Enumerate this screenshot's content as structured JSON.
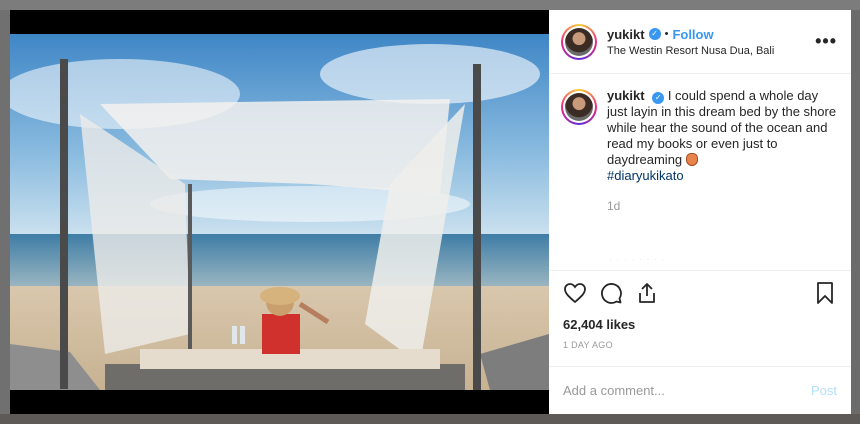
{
  "post": {
    "username": "yukikt",
    "follow_label": "Follow",
    "dot": "•",
    "location": "The Westin Resort Nusa Dua, Bali",
    "more_label": "•••",
    "caption_text": "I could spend a whole day just layin in this dream bed by the shore while hear the sound of the ocean and read my books or even just to daydreaming",
    "hashtag": "#diaryukikato",
    "caption_age": "1d",
    "likes": "62,404 likes",
    "time_ago": "1 DAY AGO",
    "comment_placeholder": "Add a comment...",
    "post_label": "Post"
  },
  "icons": {
    "verified": "verified-badge-icon",
    "like": "heart-icon",
    "comment": "comment-icon",
    "share": "share-icon",
    "save": "bookmark-icon"
  },
  "colors": {
    "link_blue": "#3897f0",
    "hashtag": "#003569",
    "muted": "#999999",
    "post_disabled": "#b2dffc"
  }
}
